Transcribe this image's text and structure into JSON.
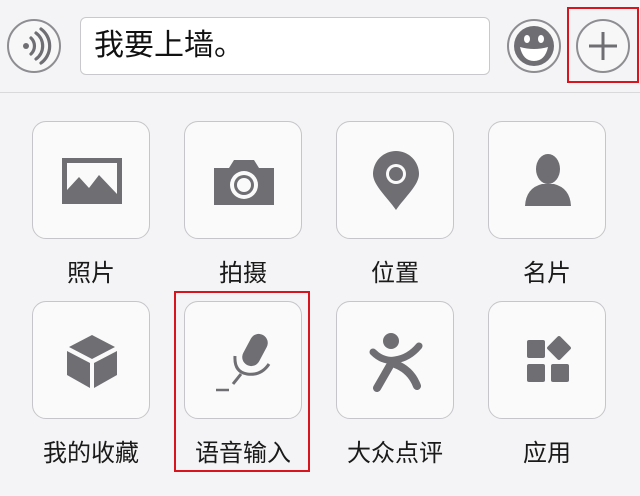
{
  "input_bar": {
    "voice_icon": "voice-wave-icon",
    "text_value": "我要上墙。",
    "emoji_icon": "smiley-icon",
    "plus_icon": "plus-icon"
  },
  "panel": {
    "items": [
      {
        "label": "照片",
        "icon": "image-icon"
      },
      {
        "label": "拍摄",
        "icon": "camera-icon"
      },
      {
        "label": "位置",
        "icon": "map-pin-icon"
      },
      {
        "label": "名片",
        "icon": "person-icon"
      },
      {
        "label": "我的收藏",
        "icon": "cube-icon"
      },
      {
        "label": "语音输入",
        "icon": "microphone-icon"
      },
      {
        "label": "大众点评",
        "icon": "dianping-icon"
      },
      {
        "label": "应用",
        "icon": "apps-grid-icon"
      }
    ]
  },
  "colors": {
    "background": "#f4f4f6",
    "icon_gray": "#6f6f73",
    "highlight_red": "#d8141c"
  }
}
